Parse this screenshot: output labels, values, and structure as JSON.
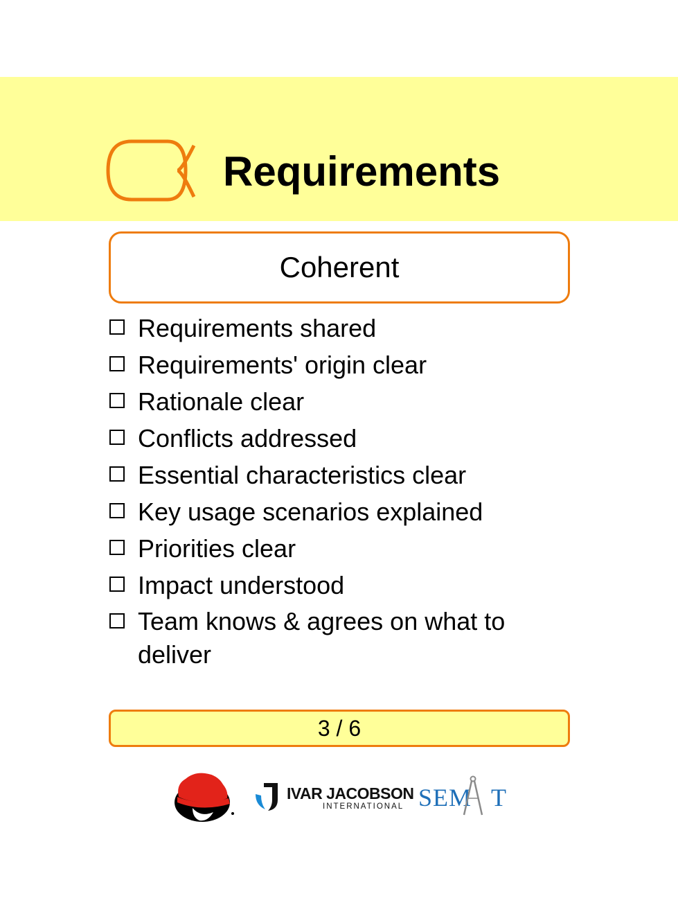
{
  "card": {
    "alpha": "Requirements",
    "state": "Coherent",
    "checklist": [
      "Requirements shared",
      "Requirements' origin clear",
      "Rationale clear",
      "Conflicts addressed",
      "Essential characteristics clear",
      "Key usage scenarios explained",
      "Priorities clear",
      "Impact understood",
      "Team knows & agrees on what to deliver"
    ],
    "page": "3 / 6"
  },
  "logos": {
    "ivar_name": "IVAR JACOBSON",
    "ivar_sub": "INTERNATIONAL",
    "semat_left": "SEM",
    "semat_right": "T"
  },
  "colors": {
    "accent": "#ee7c0e",
    "highlight": "#ffff99",
    "redhat": "#e2231a",
    "ivar_blue": "#1a8bd6",
    "semat_blue": "#1e6fb8"
  },
  "icons": [
    "alpha-requirements-icon",
    "checkbox-icon",
    "redhat-logo",
    "ivar-jacobson-logo",
    "semat-logo"
  ]
}
